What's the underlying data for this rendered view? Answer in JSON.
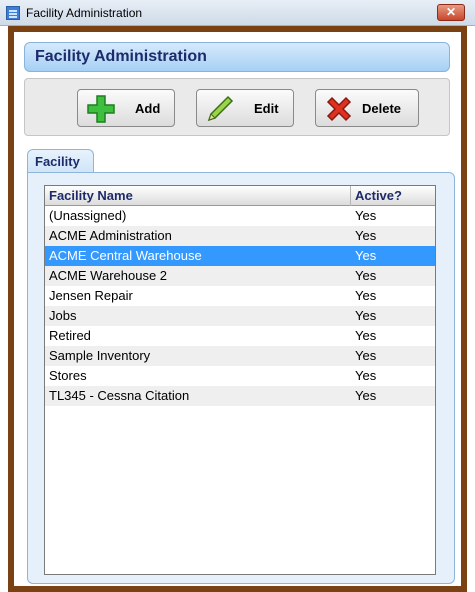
{
  "window": {
    "title": "Facility Administration",
    "close_glyph": "✕"
  },
  "header": {
    "title": "Facility Administration"
  },
  "toolbar": {
    "add_label": "Add",
    "edit_label": "Edit",
    "delete_label": "Delete",
    "add_icon": "plus-icon",
    "edit_icon": "pencil-icon",
    "delete_icon": "x-icon"
  },
  "tab": {
    "label": "Facility"
  },
  "grid": {
    "columns": [
      "Facility Name",
      "Active?"
    ],
    "selected_row": 2,
    "rows": [
      {
        "name": "(Unassigned)",
        "active": "Yes"
      },
      {
        "name": "ACME Administration",
        "active": "Yes"
      },
      {
        "name": "ACME Central Warehouse",
        "active": "Yes"
      },
      {
        "name": "ACME Warehouse 2",
        "active": "Yes"
      },
      {
        "name": "Jensen Repair",
        "active": "Yes"
      },
      {
        "name": "Jobs",
        "active": "Yes"
      },
      {
        "name": "Retired",
        "active": "Yes"
      },
      {
        "name": "Sample Inventory",
        "active": "Yes"
      },
      {
        "name": "Stores",
        "active": "Yes"
      },
      {
        "name": "TL345 - Cessna Citation",
        "active": "Yes"
      }
    ]
  },
  "colors": {
    "frame": "#7a4212",
    "selection": "#3399ff",
    "header_text": "#1d2b6b",
    "add_icon": "#3fbf3f",
    "delete_icon": "#e03020"
  }
}
